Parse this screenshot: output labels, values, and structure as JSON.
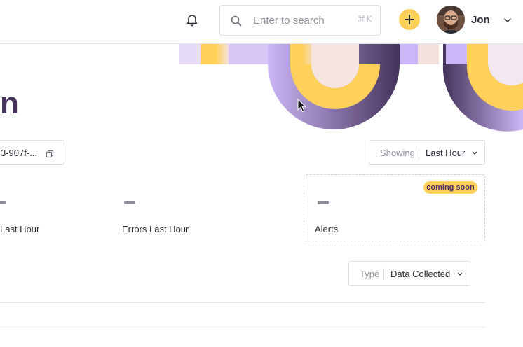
{
  "header": {
    "search": {
      "placeholder": "Enter to search",
      "shortcut": "⌘K"
    },
    "user": {
      "name": "Jon"
    },
    "icons": [
      "bell-icon",
      "search-icon",
      "plus-icon",
      "chevron-down-icon"
    ]
  },
  "page": {
    "title_fragment": "n",
    "id_chip": {
      "value": "3-907f-...",
      "icon": "copy-icon"
    }
  },
  "filters": {
    "showing": {
      "label": "Showing",
      "value": "Last Hour"
    },
    "type": {
      "label": "Type",
      "value": "Data Collected"
    }
  },
  "stats": [
    {
      "label": "Last Hour",
      "value": "—"
    },
    {
      "label": "Errors Last Hour",
      "value": "—"
    },
    {
      "label": "Alerts",
      "value": "—",
      "badge": "coming soon"
    }
  ],
  "colors": {
    "accent_yellow": "#ffd15b",
    "deep_purple": "#45325a",
    "lavender": "#cdb6f7"
  }
}
